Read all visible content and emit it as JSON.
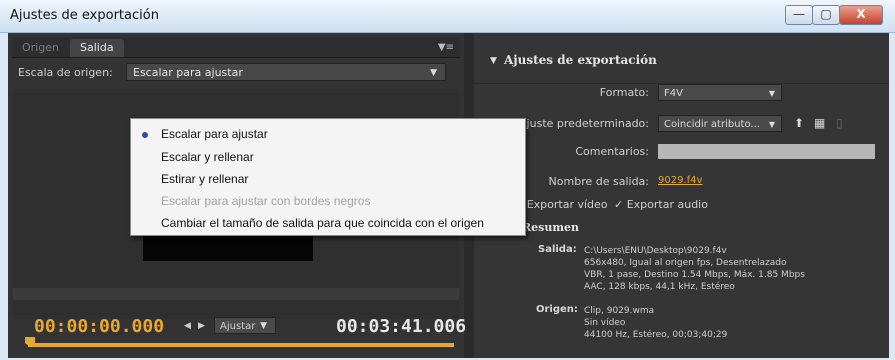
{
  "window": {
    "title": "Ajustes de exportación",
    "buttons": [
      "—",
      "▢",
      "X"
    ]
  },
  "left": {
    "tabs": [
      "Origen",
      "Salida"
    ],
    "scale_label": "Escala de origen:",
    "scale_value": "Escalar para ajustar",
    "dropdown_options": [
      "Escalar para ajustar",
      "Escalar y rellenar",
      "Estirar y rellenar",
      "Escalar para ajustar con bordes negros",
      "Cambiar el tamaño de salida para que coincida con el origen"
    ],
    "timecode_start": "00:00:00.000",
    "timecode_end": "00:03:41.006",
    "fit_label": "Ajustar"
  },
  "right": {
    "header": "Ajustes de exportación",
    "format_label": "Formato:",
    "format_value": "F4V",
    "preset_label": "Ajuste predeterminado:",
    "preset_value": "Coincidir atributo...",
    "comments_label": "Comentarios:",
    "output_label": "Nombre de salida:",
    "output_value": "9029.f4v",
    "export_video": "Exportar vídeo",
    "export_audio": "Exportar audio",
    "summary_header": "Resumen",
    "output_summary_label": "Salida:",
    "output_summary": [
      "C:\\Users\\ENU\\Desktop\\9029.f4v",
      "656x480, Igual al origen fps, Desentrelazado",
      "VBR, 1 pase, Destino 1.54 Mbps, Máx. 1.85 Mbps",
      "AAC, 128 kbps, 44,1 kHz, Estéreo"
    ],
    "source_summary_label": "Origen:",
    "source_summary": [
      "Clip, 9029.wma",
      "Sin vídeo",
      "44100 Hz, Estéreo, 00;03;40;29"
    ]
  },
  "colors": {
    "accent": "#e8a82e",
    "panel": "#353535",
    "highlight": "#314a9e"
  }
}
